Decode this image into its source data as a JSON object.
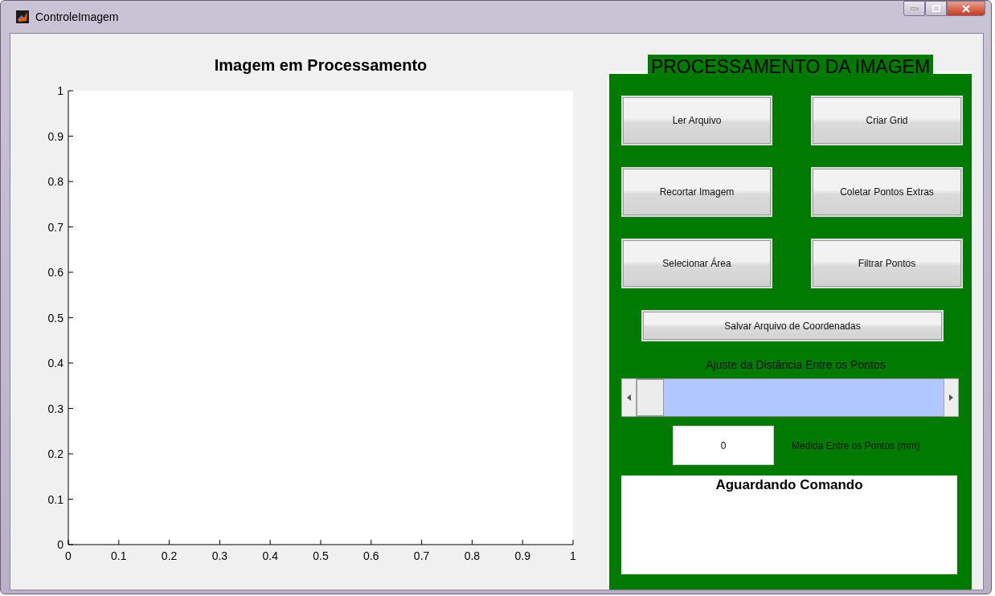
{
  "window": {
    "title": "ControleImagem"
  },
  "axes": {
    "chart_data": {
      "type": "line",
      "title": "Imagem em Processamento",
      "xlim": [
        0,
        1
      ],
      "ylim": [
        0,
        1
      ],
      "xticks": [
        0,
        0.1,
        0.2,
        0.3,
        0.4,
        0.5,
        0.6,
        0.7,
        0.8,
        0.9,
        1
      ],
      "yticks": [
        0,
        0.1,
        0.2,
        0.3,
        0.4,
        0.5,
        0.6,
        0.7,
        0.8,
        0.9,
        1
      ]
    }
  },
  "panel": {
    "title": "PROCESSAMENTO DA IMAGEM",
    "buttons": [
      "Ler Arquivo",
      "Criar Grid",
      "Recortar Imagem",
      "Coletar Pontos Extras",
      "Selecionar Área",
      "Filtrar Pontos"
    ],
    "save_button": "Salvar Arquivo de Coordenadas",
    "slider": {
      "label": "Ajuste da Distância Entre os Pontos",
      "level": 0
    },
    "measure": {
      "value": "0",
      "label": "Medida Entre os Pontos (mm)"
    },
    "status": "Aguardando Comando"
  }
}
